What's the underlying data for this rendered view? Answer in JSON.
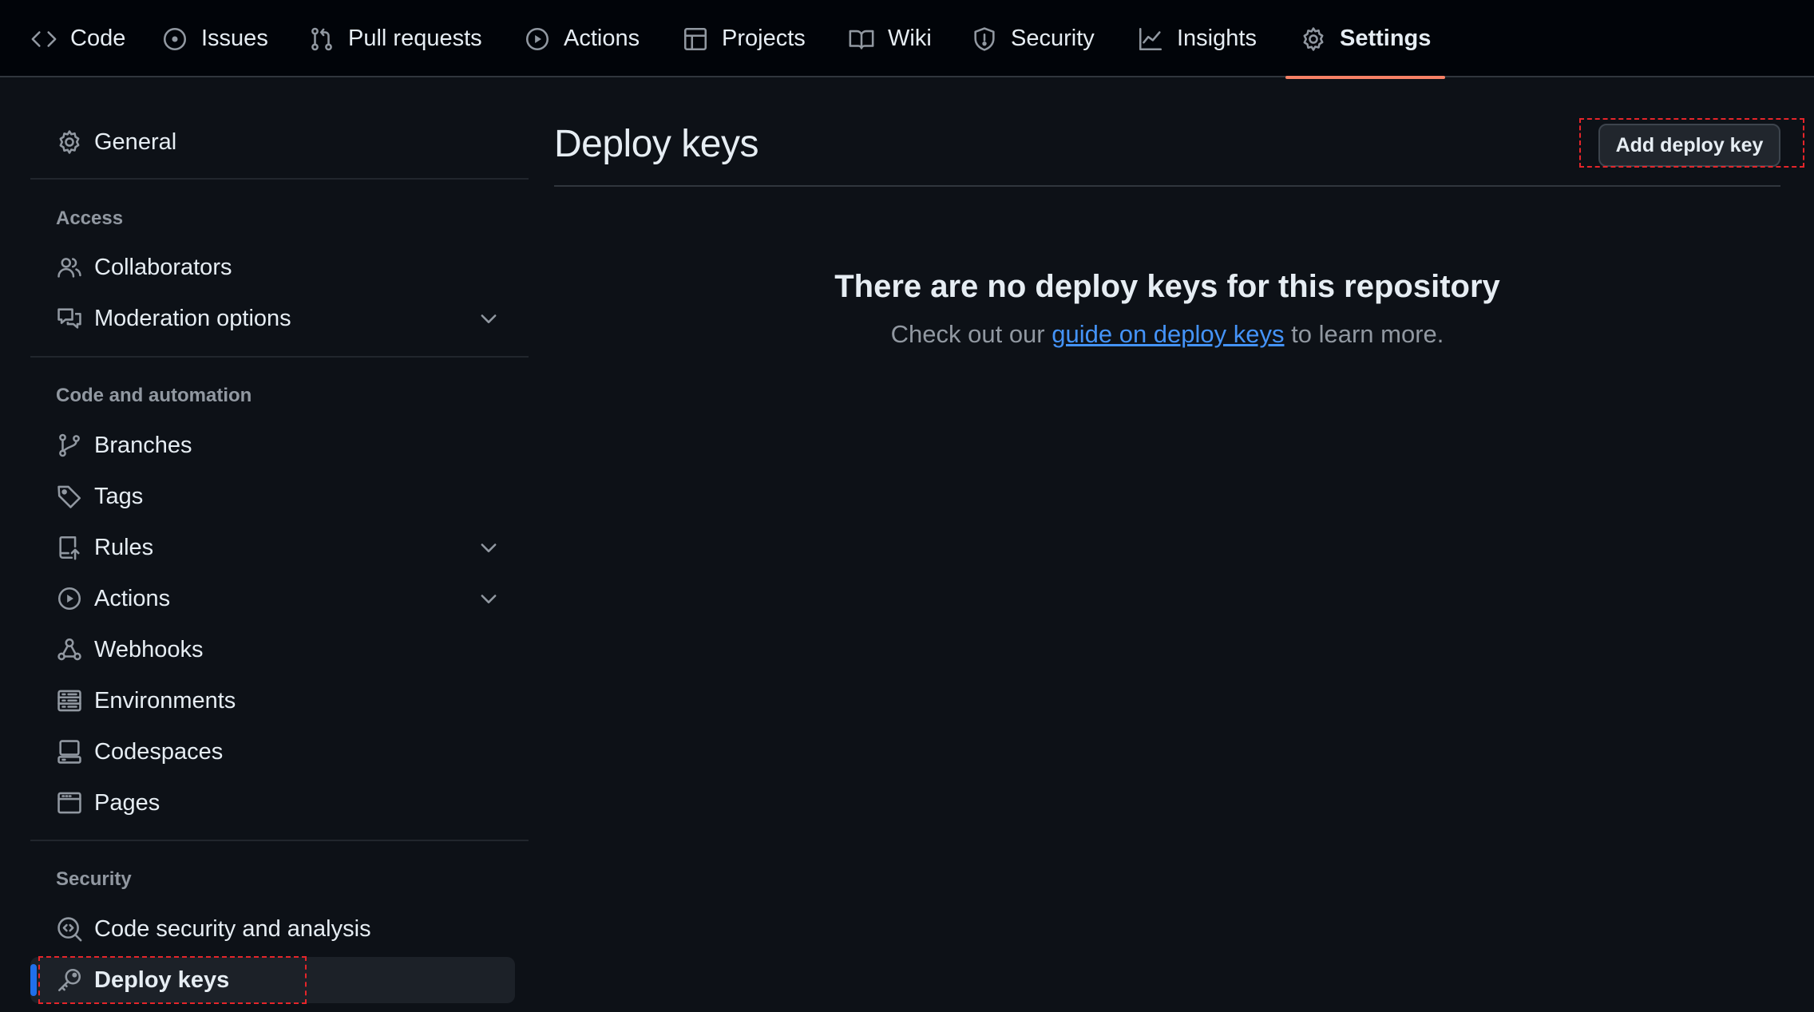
{
  "topnav": {
    "tabs": [
      {
        "label": "Code",
        "icon": "code-icon"
      },
      {
        "label": "Issues",
        "icon": "issue-icon"
      },
      {
        "label": "Pull requests",
        "icon": "pull-request-icon"
      },
      {
        "label": "Actions",
        "icon": "play-icon"
      },
      {
        "label": "Projects",
        "icon": "table-icon"
      },
      {
        "label": "Wiki",
        "icon": "book-icon"
      },
      {
        "label": "Security",
        "icon": "shield-icon"
      },
      {
        "label": "Insights",
        "icon": "graph-icon"
      },
      {
        "label": "Settings",
        "icon": "gear-icon",
        "active": true
      }
    ]
  },
  "sidebar": {
    "general": "General",
    "sections": {
      "access": "Access",
      "code_automation": "Code and automation",
      "security": "Security"
    },
    "items": {
      "collaborators": "Collaborators",
      "moderation": "Moderation options",
      "branches": "Branches",
      "tags": "Tags",
      "rules": "Rules",
      "actions": "Actions",
      "webhooks": "Webhooks",
      "environments": "Environments",
      "codespaces": "Codespaces",
      "pages": "Pages",
      "code_security": "Code security and analysis",
      "deploy_keys": "Deploy keys"
    }
  },
  "main": {
    "title": "Deploy keys",
    "add_button": "Add deploy key",
    "blankslate": {
      "title": "There are no deploy keys for this repository",
      "text_before": "Check out our ",
      "link": "guide on deploy keys",
      "text_after": " to learn more."
    }
  },
  "colors": {
    "background": "#0d1117",
    "topnav_bg": "#010409",
    "accent_underline": "#f78166",
    "link": "#4493f8",
    "active_bar": "#1f6feb",
    "highlight": "#e5252a"
  }
}
